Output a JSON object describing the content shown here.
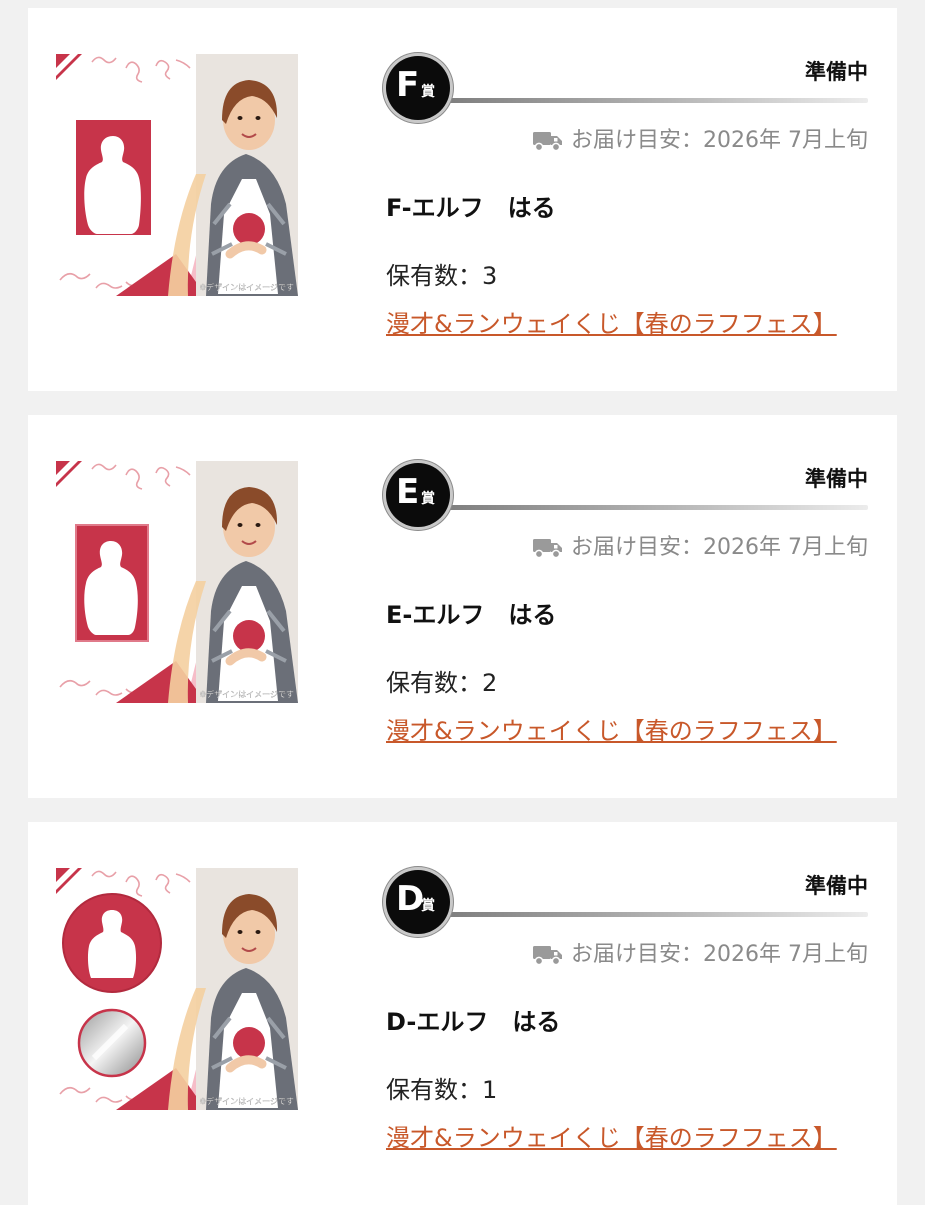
{
  "prizes": [
    {
      "grade_letter": "F",
      "grade_suffix": "賞",
      "status": "準備中",
      "delivery_label": "お届け目安：2026年 7月上旬",
      "item_name": "F-エルフ　はる",
      "count_label": "保有数：3",
      "lottery_link": "漫才&ランウェイくじ【春のラフフェス】",
      "image_watermark": "※デザインはイメージです",
      "image_type": "acrylic-stand"
    },
    {
      "grade_letter": "E",
      "grade_suffix": "賞",
      "status": "準備中",
      "delivery_label": "お届け目安：2026年 7月上旬",
      "item_name": "E-エルフ　はる",
      "count_label": "保有数：2",
      "lottery_link": "漫才&ランウェイくじ【春のラフフェス】",
      "image_watermark": "※デザインはイメージです",
      "image_type": "photo-card"
    },
    {
      "grade_letter": "D",
      "grade_suffix": "賞",
      "status": "準備中",
      "delivery_label": "お届け目安：2026年 7月上旬",
      "item_name": "D-エルフ　はる",
      "count_label": "保有数：1",
      "lottery_link": "漫才&ランウェイくじ【春のラフフェス】",
      "image_watermark": "※デザインはイメージです",
      "image_type": "can-badge"
    }
  ],
  "icons": {
    "delivery": "truck-icon"
  },
  "colors": {
    "accent_red": "#c7344a",
    "link": "#c8582a",
    "status_text": "#111111",
    "muted": "#8a8a8a"
  }
}
